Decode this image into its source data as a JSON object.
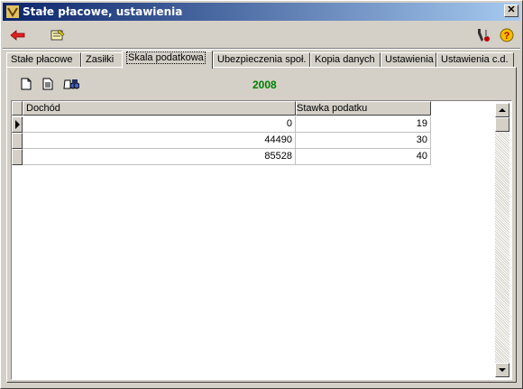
{
  "window": {
    "title": "Stałe płacowe, ustawienia"
  },
  "toolbar": {
    "icons": [
      "back-arrow-icon",
      "notes-icon",
      "tools-icon",
      "help-icon"
    ]
  },
  "tabs": [
    {
      "label": "Stałe płacowe",
      "active": false
    },
    {
      "label": "Zasiłki",
      "active": false
    },
    {
      "label": "Skala podatkowa",
      "active": true
    },
    {
      "label": "Ubezpieczenia społ.",
      "active": false
    },
    {
      "label": "Kopia danych",
      "active": false
    },
    {
      "label": "Ustawienia",
      "active": false
    },
    {
      "label": "Ustawienia c.d.",
      "active": false
    }
  ],
  "tax_panel": {
    "year": "2008",
    "columns": [
      "Dochód",
      "Stawka podatku"
    ],
    "rows": [
      {
        "income": "0",
        "rate": "19",
        "current": true
      },
      {
        "income": "44490",
        "rate": "30",
        "current": false
      },
      {
        "income": "85528",
        "rate": "40",
        "current": false
      }
    ]
  },
  "colors": {
    "year_text": "#008000",
    "title_bar": "#0a246a",
    "face": "#d4d0c8"
  }
}
